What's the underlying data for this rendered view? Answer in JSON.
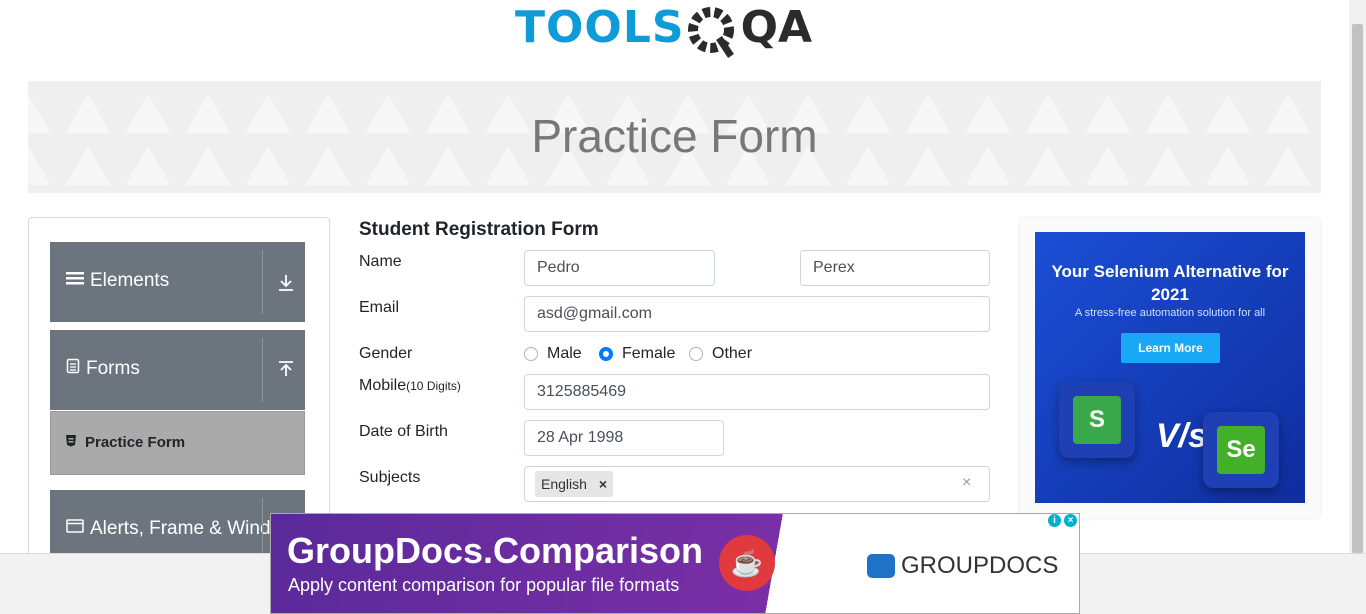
{
  "logo": {
    "tools": "TOOLS",
    "qa": "QA"
  },
  "banner": {
    "title": "Practice Form"
  },
  "sidebar": {
    "groups": [
      {
        "label": "Elements",
        "icon": "hamburger-icon",
        "arrow": "⤓"
      },
      {
        "label": "Forms",
        "icon": "document-icon",
        "arrow": "⤒"
      },
      {
        "label": "Alerts, Frame & Windows",
        "icon": "window-icon",
        "arrow": ""
      }
    ],
    "active_item": {
      "label": "Practice Form",
      "icon": "html-icon"
    }
  },
  "form": {
    "title": "Student Registration Form",
    "name_label": "Name",
    "first_name": "Pedro",
    "last_name": "Perex",
    "email_label": "Email",
    "email": "asd@gmail.com",
    "gender_label": "Gender",
    "gender_options": [
      "Male",
      "Female",
      "Other"
    ],
    "gender_selected": "Female",
    "mobile_label": "Mobile",
    "mobile_hint": "(10 Digits)",
    "mobile": "3125885469",
    "dob_label": "Date of Birth",
    "dob": "28 Apr 1998",
    "subjects_label": "Subjects",
    "subject_chip": "English",
    "chip_remove": "×",
    "clear": "×"
  },
  "side_ad": {
    "headline": "Your Selenium Alternative for 2021",
    "sub": "A stress-free automation solution for all",
    "button": "Learn More",
    "vs": "V/s",
    "left_tile": "S",
    "right_tile": "Se"
  },
  "bottom_ad": {
    "headline": "GroupDocs.Comparison",
    "subline": "Apply content comparison for popular file formats",
    "brand": "GROUPDOCS",
    "info": "i",
    "close": "×"
  },
  "colors": {
    "brand_blue": "#0f9ad8",
    "sidebar_gray": "#6c757d",
    "radio_blue": "#007bff",
    "ad_purple": "#5a2a9a"
  }
}
